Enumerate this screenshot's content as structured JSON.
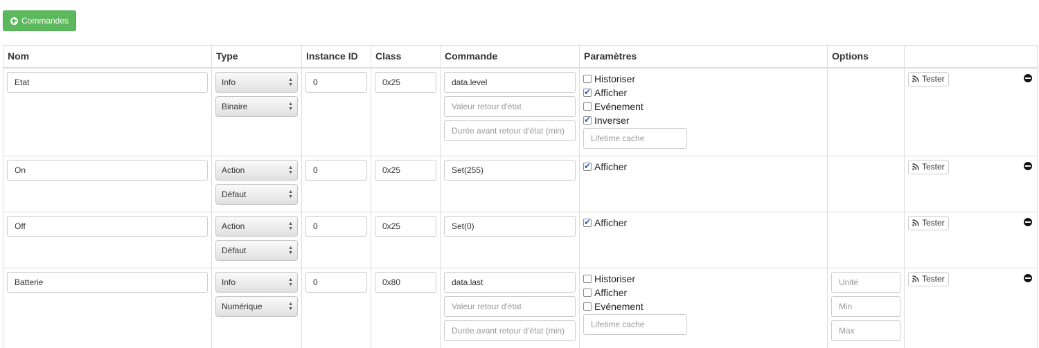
{
  "toolbar": {
    "add_label": "Commandes"
  },
  "table": {
    "headers": {
      "nom": "Nom",
      "type": "Type",
      "instance": "Instance ID",
      "class": "Class",
      "commande": "Commande",
      "parametres": "Paramètres",
      "options": "Options"
    },
    "rows": [
      {
        "nom": "Etat",
        "type": "Info",
        "subtype": "Binaire",
        "instance": "0",
        "class": "0x25",
        "commande": "data.level",
        "valeur_placeholder": "Valeur retour d'état",
        "duree_placeholder": "Durée avant retour d'état (min)",
        "params": [
          {
            "label": "Historiser",
            "checked": false
          },
          {
            "label": "Afficher",
            "checked": true
          },
          {
            "label": "Evénement",
            "checked": false
          },
          {
            "label": "Inverser",
            "checked": true
          }
        ],
        "lifetime_placeholder": "Lifetime cache",
        "tester": "Tester"
      },
      {
        "nom": "On",
        "type": "Action",
        "subtype": "Défaut",
        "instance": "0",
        "class": "0x25",
        "commande": "Set(255)",
        "params": [
          {
            "label": "Afficher",
            "checked": true
          }
        ],
        "tester": "Tester"
      },
      {
        "nom": "Off",
        "type": "Action",
        "subtype": "Défaut",
        "instance": "0",
        "class": "0x25",
        "commande": "Set(0)",
        "params": [
          {
            "label": "Afficher",
            "checked": true
          }
        ],
        "tester": "Tester"
      },
      {
        "nom": "Batterie",
        "type": "Info",
        "subtype": "Numérique",
        "instance": "0",
        "class": "0x80",
        "commande": "data.last",
        "valeur_placeholder": "Valeur retour d'état",
        "duree_placeholder": "Durée avant retour d'état (min)",
        "params": [
          {
            "label": "Historiser",
            "checked": false
          },
          {
            "label": "Afficher",
            "checked": false
          },
          {
            "label": "Evénement",
            "checked": false
          }
        ],
        "lifetime_placeholder": "Lifetime cache",
        "options": {
          "unite": "Unité",
          "min": "Min",
          "max": "Max"
        },
        "tester": "Tester"
      }
    ]
  },
  "icons": {
    "add": "plus-circle-icon",
    "tester": "rss-icon",
    "remove": "minus-circle-icon"
  },
  "colors": {
    "add_button": "#5cb85c",
    "checkbox_check": "#1d5fb5"
  }
}
